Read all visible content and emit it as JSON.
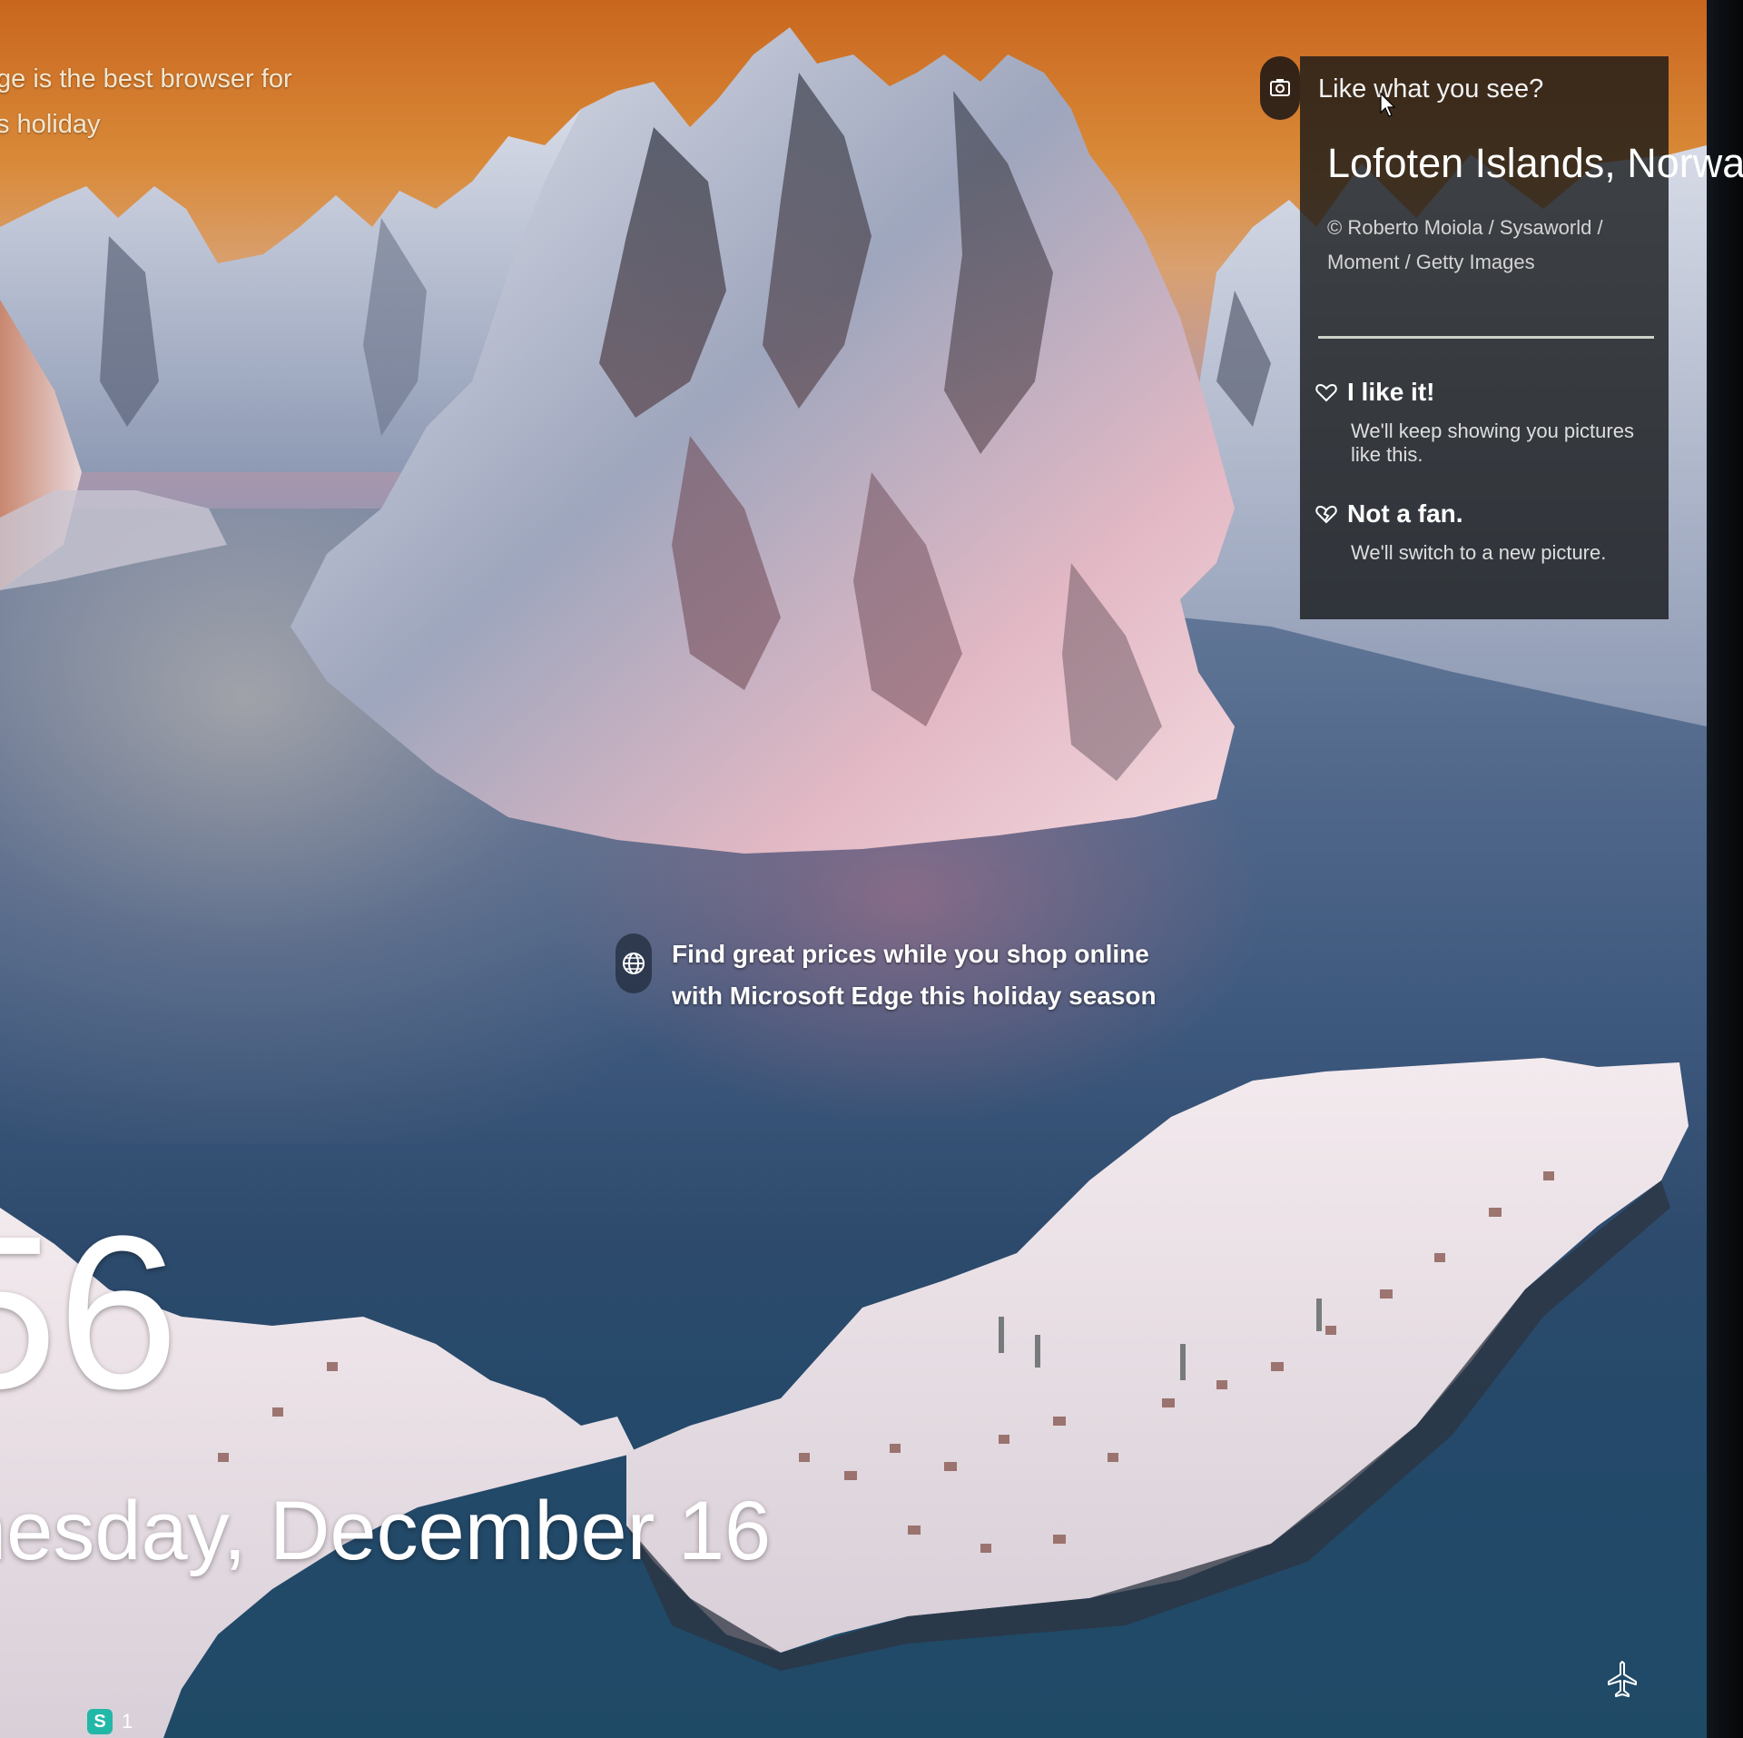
{
  "ad_topleft": {
    "line1": "ge is the best browser for",
    "line2": "s holiday"
  },
  "spotlight": {
    "question": "Like what you see?",
    "location": "Lofoten Islands, Norway",
    "credit": "© Roberto Moiola / Sysaworld / Moment / Getty Images",
    "like": {
      "title": "I like it!",
      "description": "We'll keep showing you pictures like this."
    },
    "dislike": {
      "title": "Not a fan.",
      "description": "We'll switch to a new picture."
    }
  },
  "ad_center": {
    "line1": "Find great prices while you shop online",
    "line2": "with Microsoft Edge this holiday season"
  },
  "clock": {
    "time": "56",
    "date": "nesday, December 16"
  },
  "status": {
    "badge": "S",
    "count": "1"
  },
  "icons": {
    "camera": "camera-icon",
    "heart": "heart-icon",
    "heart_broken": "heart-broken-icon",
    "globe": "globe-icon",
    "airplane": "airplane-icon"
  },
  "colors": {
    "panel_bg": "#121416",
    "divider": "#cfd2c8",
    "badge": "#22b8a8"
  }
}
